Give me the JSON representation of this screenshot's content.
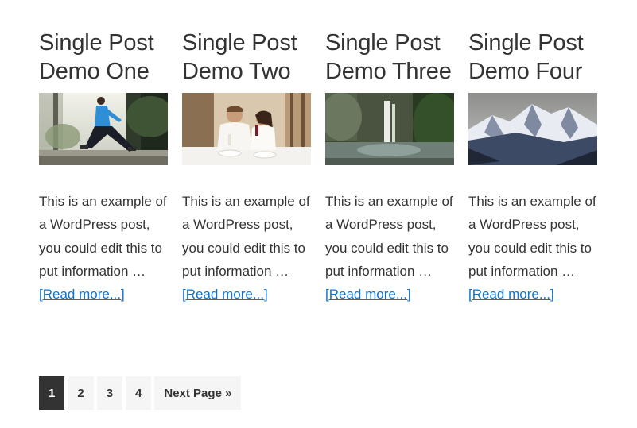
{
  "posts": [
    {
      "title_line1": "Single Post",
      "title_line2": "Demo One",
      "image": "runner-stretching-photo",
      "excerpt_lines": [
        "This is an example of",
        "a WordPress post,",
        "you could edit this to",
        "put information …"
      ],
      "read_more": "[Read more...]"
    },
    {
      "title_line1": "Single Post",
      "title_line2": "Demo Two",
      "image": "couple-dining-photo",
      "excerpt_lines": [
        "This is an example of",
        "a WordPress post,",
        "you could edit this to",
        "put information …"
      ],
      "read_more": "[Read more...]"
    },
    {
      "title_line1": "Single Post",
      "title_line2": "Demo Three",
      "image": "waterfall-photo",
      "excerpt_lines": [
        "This is an example of",
        "a WordPress post,",
        "you could edit this to",
        "put information …"
      ],
      "read_more": "[Read more...]"
    },
    {
      "title_line1": "Single Post",
      "title_line2": "Demo Four",
      "image": "snowy-mountains-photo",
      "excerpt_lines": [
        "This is an example of",
        "a WordPress post,",
        "you could edit this to",
        "put information …"
      ],
      "read_more": "[Read more...]"
    }
  ],
  "pagination": {
    "pages": [
      "1",
      "2",
      "3",
      "4"
    ],
    "current": "1",
    "next_label": "Next Page »"
  },
  "colors": {
    "text": "#333333",
    "link": "#0b74d1",
    "pager_bg": "#f5f5f5",
    "pager_active_bg": "#333333"
  }
}
